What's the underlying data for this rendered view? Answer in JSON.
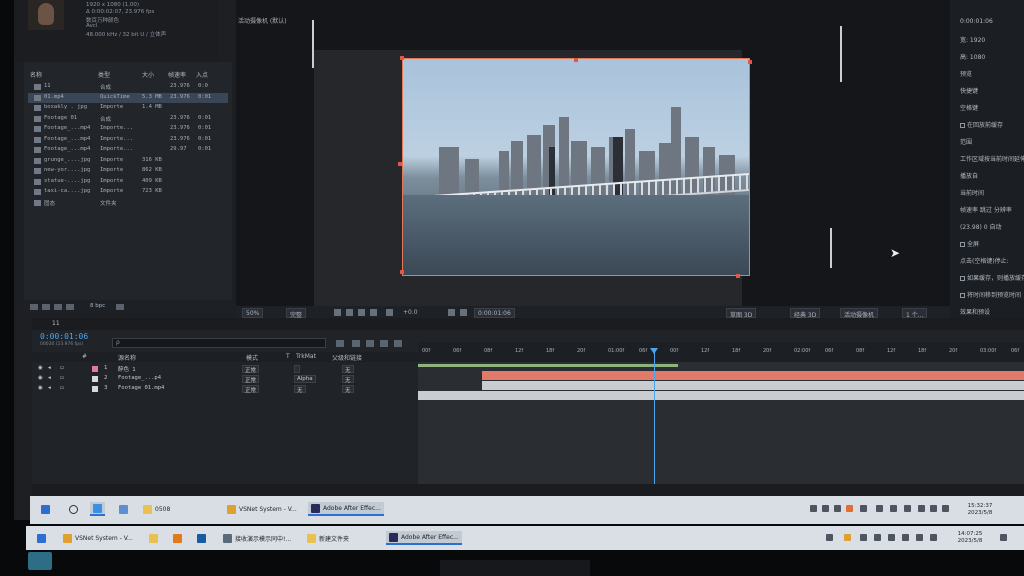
{
  "source_info": {
    "line1": "1920 x 1080 (1.00)",
    "line2": "Δ 0:00:02:07, 23.976 fps",
    "line3": "数百万种颜色",
    "line4": "Avcl",
    "line5": "48.000 kHz / 32 bit U / 立体声"
  },
  "viewer": {
    "camera_label": "活动摄像机 (默认)"
  },
  "project": {
    "columns": {
      "name": "名称",
      "type": "类型",
      "size": "大小",
      "fps": "帧速率",
      "in": "入点"
    },
    "items": [
      {
        "name": "11",
        "type": "合成",
        "size": "",
        "fps": "23.976",
        "in": "0:0"
      },
      {
        "name": "01.mp4",
        "type": "QuickTime",
        "size": "5.3 MB",
        "fps": "23.976",
        "in": "0:01"
      },
      {
        "name": "boxakly . jpg",
        "type": "Importe",
        "size": "1.4 MB",
        "fps": "",
        "in": ""
      },
      {
        "name": "Footage 01",
        "type": "合成",
        "size": "",
        "fps": "23.976",
        "in": "0:01"
      },
      {
        "name": "Footage_...mp4",
        "type": "Importe...",
        "size": "",
        "fps": "23.976",
        "in": "0:01"
      },
      {
        "name": "Footage_...mp4",
        "type": "Importe...",
        "size": "",
        "fps": "23.976",
        "in": "0:01"
      },
      {
        "name": "Footage_...mp4",
        "type": "Importe...",
        "size": "",
        "fps": "29.97",
        "in": "0:01"
      },
      {
        "name": "grunge_....jpg",
        "type": "Importe",
        "size": "316 KB",
        "fps": "",
        "in": ""
      },
      {
        "name": "new-yor....jpg",
        "type": "Importe",
        "size": "862 KB",
        "fps": "",
        "in": ""
      },
      {
        "name": "statue-....jpg",
        "type": "Importe",
        "size": "409 KB",
        "fps": "",
        "in": ""
      },
      {
        "name": "taxi-ca....jpg",
        "type": "Importe",
        "size": "723 KB",
        "fps": "",
        "in": ""
      },
      {
        "name": "固态",
        "type": "文件夹",
        "size": "",
        "fps": "",
        "in": ""
      }
    ],
    "bpc": "8 bpc"
  },
  "viewer_bar": {
    "zoom": "50%",
    "resolution": "完整",
    "exposure": "+0.0",
    "timecode": "0:00:01:06",
    "draft3d": "草图 3D",
    "renderer": "经典 3D",
    "camera": "活动摄像机",
    "views": "1 个..."
  },
  "right_panel": {
    "lines": [
      "0:00:01:06",
      "宽: 1920",
      "高: 1080",
      "预览",
      "快捷键",
      "空格键",
      "在回放前缓存",
      "范围",
      "工作区域按当前时间延伸",
      "播放自",
      "当前时间",
      "帧速率  跳过  分辨率",
      "(23.98)  0  自动",
      "全屏",
      "点击(空格键)停止:",
      "如果缓存，则播放缓存帧",
      "将时间移到预览时间",
      "效果和预设"
    ]
  },
  "timeline": {
    "comp_tab": "11",
    "timecode": "0:00:01:06",
    "timecode_sub": "00030 (23.976 fps)",
    "search_placeholder": "ρ",
    "headers": {
      "num": "#",
      "name": "源名称",
      "mode": "模式",
      "t": "T",
      "trkmat": "TrkMat",
      "parent": "父级和链接"
    },
    "ruler_ticks": [
      "00f",
      "06f",
      "08f",
      "12f",
      "18f",
      "20f",
      "01:00f",
      "06f",
      "00f",
      "12f",
      "18f",
      "20f",
      "02:00f",
      "06f",
      "08f",
      "12f",
      "18f",
      "20f",
      "03:00f",
      "06f"
    ],
    "layers": [
      {
        "num": "1",
        "name": "醉色 1",
        "mode": "正常",
        "trkmat": "",
        "parent": "无",
        "color": "#e07aa0"
      },
      {
        "num": "2",
        "name": "Footage_...p4",
        "mode": "正常",
        "trkmat": "Alpha",
        "parent": "无",
        "color": "#d6d9dd"
      },
      {
        "num": "3",
        "name": "Footage 01.mp4",
        "mode": "正常",
        "trkmat": "无",
        "parent": "无",
        "color": "#d6d9dd"
      }
    ]
  },
  "taskbar_inner": {
    "items": [
      "0508",
      "VSNet System - V...",
      "Adobe After Effec..."
    ],
    "clock_time": "15:32:37",
    "clock_date": "2023/5/8"
  },
  "taskbar_outer": {
    "items": [
      "VSNet System - V...",
      "接收演示模示同中!...",
      "新建文件夹",
      "Adobe After Effec..."
    ],
    "clock_time": "14:07:25",
    "clock_date": "2023/5/8"
  },
  "colors": {
    "accent": "#4aa6f0",
    "layer_bar_pink": "#e07a6a",
    "layer_bar_gray": "#c9cdd1",
    "selection": "#e07a5a"
  }
}
